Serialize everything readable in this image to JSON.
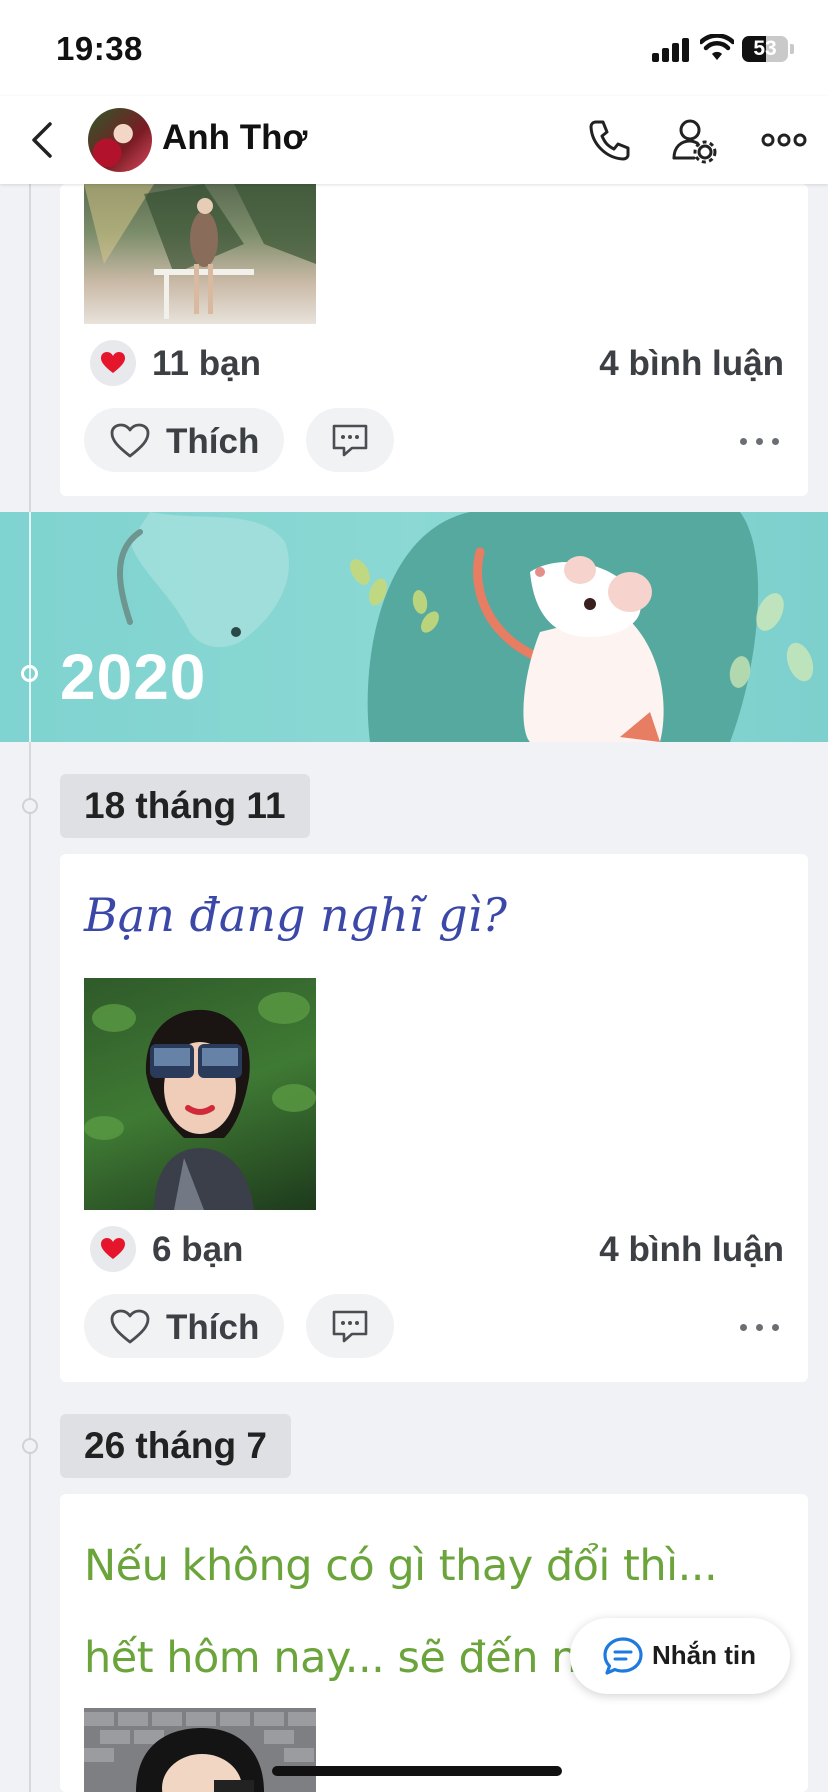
{
  "status_bar": {
    "time": "19:38",
    "battery_level": "53",
    "battery_percent": 53
  },
  "header": {
    "name": "Anh Thơ",
    "icons": [
      "back-chevron-icon",
      "avatar",
      "phone-icon",
      "user-settings-icon",
      "more-horizontal-icon"
    ]
  },
  "feed": {
    "post1": {
      "likes": "11 bạn",
      "comments": "4 bình luận",
      "like_label": "Thích"
    },
    "banner": {
      "year": "2020"
    },
    "post2": {
      "date": "18 tháng 11",
      "text": "Bạn đang nghĩ gì?",
      "likes": "6 bạn",
      "comments": "4 bình luận",
      "like_label": "Thích"
    },
    "post3": {
      "date": "26 tháng 7",
      "text": "Nếu không có gì thay đổi thì... hết hôm nay... sẽ đến ngày m"
    }
  },
  "message_button": {
    "label": "Nhắn tin"
  },
  "colors": {
    "accent_blue": "#1f7ae0",
    "heart_red": "#e5162b",
    "script_text": "#3b48a8",
    "green_text": "#6aa43a",
    "banner_teal": "#7fd3d0"
  }
}
